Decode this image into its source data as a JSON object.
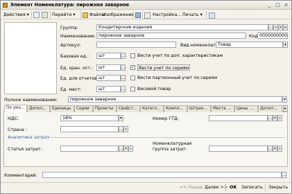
{
  "window": {
    "title": "Элемент Номенклатура: пирожное заварное",
    "controls": [
      "_",
      "□",
      "×"
    ]
  },
  "toolbar": {
    "actions": "Действия",
    "go": "Перейти",
    "files": "Файлы",
    "image": "Изображение",
    "settings": "Настройка...",
    "print": "Печать"
  },
  "form": {
    "group_label": "Группа:",
    "group_value": "Кондитерские изделия",
    "name_label": "Наименование:",
    "name_value": "пирожное заварное",
    "code_label": "Код:",
    "code_value": "00000000003",
    "article_label": "Артикул:",
    "article_value": "",
    "kind_label": "Вид номенклатуры:",
    "kind_value": "Товар",
    "base_unit_label": "Базовая ед.:",
    "base_unit_value": "шт",
    "storage_unit_label": "Ед. хран. ост.:",
    "storage_unit_value": "шт",
    "report_unit_label": "Ед. для отчетов:",
    "report_unit_value": "шт",
    "place_unit_label": "Ед. мест:",
    "place_unit_value": "шт",
    "chk_characteristics": "Вести учет по доп. характеристикам",
    "chk_series": "Вести учет по сериям",
    "chk_batch": "Вести партионный учет по сериям",
    "chk_weight": "Весовой товар",
    "chk_series_checked": "✓",
    "full_name_label": "Полное наименование:",
    "full_name_value": "пирожное заварное"
  },
  "tabs": [
    "По умо...",
    "Допол...",
    "Единицы",
    "Серии",
    "Проекты",
    "Свойст...",
    "Катего...",
    "Компл...",
    "Штрих...",
    "Места ...",
    "Цены ...",
    "Допол..."
  ],
  "tab_main": {
    "vat_label": "НДС:",
    "vat_value": "18%",
    "gtd_label": "Номер ГТД:",
    "gtd_value": "",
    "country_label": "Страна :",
    "country_value": "",
    "cost_header": "Аналитика затрат",
    "cost_item_label": "Статья затрат:",
    "cost_item_value": "",
    "nomgroup_label": "Номенклатурная группа затрат:",
    "nomgroup_value": ""
  },
  "comment": {
    "label": "Комментарий:",
    "value": ""
  },
  "footer": {
    "back": "<< Назад",
    "next": "Далее >>",
    "ok": "OK",
    "write": "Записать",
    "close": "Закрыть"
  }
}
